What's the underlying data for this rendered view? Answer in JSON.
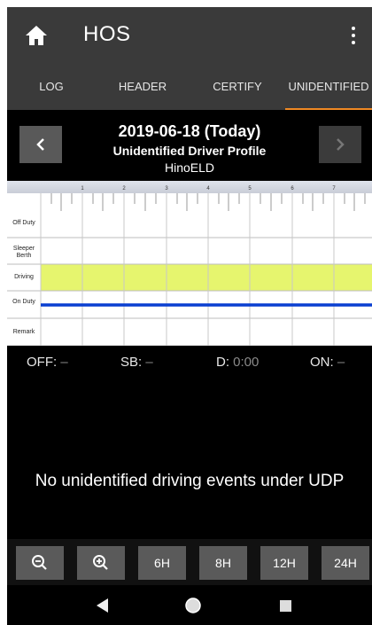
{
  "app": {
    "title": "HOS"
  },
  "tabs": [
    {
      "label": "LOG",
      "active": false
    },
    {
      "label": "HEADER",
      "active": false
    },
    {
      "label": "CERTIFY",
      "active": false
    },
    {
      "label": "UNIDENTIFIED",
      "active": true
    }
  ],
  "date_header": {
    "date": "2019-06-18 (Today)",
    "profile": "Unidentified Driver Profile",
    "device": "HinoELD",
    "prev_icon": "chevron-left-icon",
    "next_icon": "chevron-right-icon"
  },
  "graph": {
    "hour_labels": [
      "1",
      "2",
      "3",
      "4",
      "5",
      "6",
      "7"
    ],
    "rows": [
      "Off Duty",
      "Sleeper Berth",
      "Driving",
      "On Duty",
      "Remark"
    ],
    "highlight_color": "#e6f56e",
    "duty_line_color": "#0a3fd1"
  },
  "totals": [
    {
      "label": "OFF:",
      "value": "–"
    },
    {
      "label": "SB:",
      "value": "–"
    },
    {
      "label": "D:",
      "value": "0:00"
    },
    {
      "label": "ON:",
      "value": "–"
    }
  ],
  "message": "No unidentified driving events under UDP",
  "zoom_buttons": [
    {
      "label": "",
      "icon": "zoom-out-icon"
    },
    {
      "label": "",
      "icon": "zoom-in-icon"
    },
    {
      "label": "6H"
    },
    {
      "label": "8H"
    },
    {
      "label": "12H"
    },
    {
      "label": "24H"
    }
  ],
  "colors": {
    "accent": "#f08a24",
    "appbar": "#3a3a3a"
  }
}
